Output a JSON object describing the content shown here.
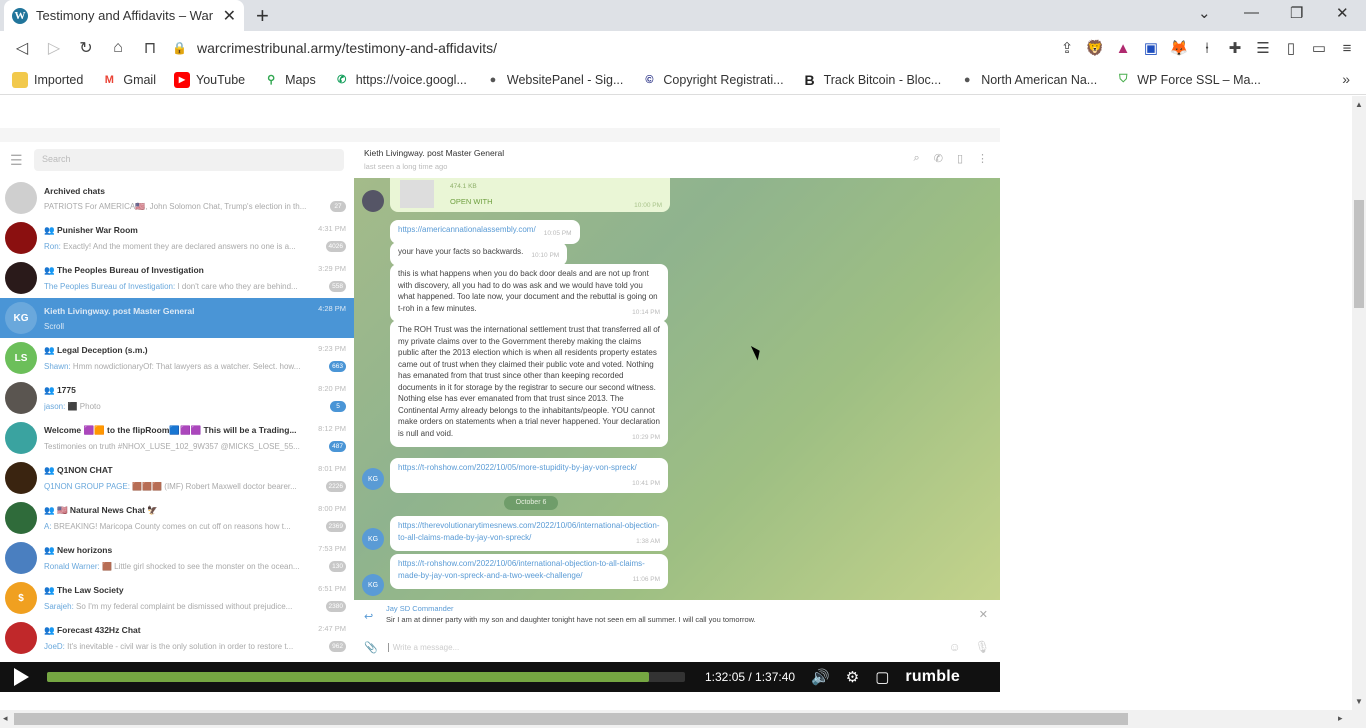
{
  "browser": {
    "tab_title": "Testimony and Affidavits – War Cr",
    "favicon": "wordpress-icon",
    "url": "warcrimestribunal.army/testimony-and-affidavits/",
    "bookmarks": [
      {
        "label": "Imported",
        "icon": "folder-icon",
        "color": "#f2c94c"
      },
      {
        "label": "Gmail",
        "icon": "gmail-icon",
        "color": "#ea4335"
      },
      {
        "label": "YouTube",
        "icon": "youtube-icon",
        "color": "#ff0000"
      },
      {
        "label": "Maps",
        "icon": "maps-icon",
        "color": "#34a853"
      },
      {
        "label": "https://voice.googl...",
        "icon": "phone-icon",
        "color": "#0f9d58"
      },
      {
        "label": "WebsitePanel - Sig...",
        "icon": "globe-icon",
        "color": "#555555"
      },
      {
        "label": "Copyright Registrati...",
        "icon": "copyright-icon",
        "color": "#1a237e"
      },
      {
        "label": "Track Bitcoin - Bloc...",
        "icon": "b-icon",
        "color": "#222222"
      },
      {
        "label": "North American Na...",
        "icon": "globe-icon",
        "color": "#555555"
      },
      {
        "label": "WP Force SSL – Ma...",
        "icon": "shield-icon",
        "color": "#4caf50"
      }
    ]
  },
  "telegram": {
    "search_placeholder": "Search",
    "chats": [
      {
        "name": "Archived chats",
        "preview": "PATRIOTS For AMERICA🇺🇸, John Solomon Chat, Trump's election in th...",
        "sender": "",
        "time": "",
        "badge": "27",
        "avatar_color": "#cfcfcf",
        "initials": "",
        "group": false
      },
      {
        "name": "Punisher War Room",
        "sender": "Ron:",
        "preview": "Exactly! And the moment they are declared answers no one is a...",
        "time": "4:31 PM",
        "badge": "4026",
        "avatar_color": "#8b1010",
        "initials": "",
        "group": true
      },
      {
        "name": "The Peoples Bureau of Investigation",
        "sender": "The Peoples Bureau of Investigation:",
        "preview": "I don't care who they are behind...",
        "time": "3:29 PM",
        "badge": "558",
        "avatar_color": "#2a1a1a",
        "initials": "",
        "group": true
      },
      {
        "name": "Kieth Livingway. post Master General",
        "sender": "",
        "preview": "Scroll",
        "time": "4:28 PM",
        "badge": "",
        "avatar_color": "#6aa8dc",
        "initials": "KG",
        "group": false,
        "selected": true
      },
      {
        "name": "Legal Deception (s.m.)",
        "sender": "Shawn:",
        "preview": "Hmm nowdictionaryOf: That lawyers as a watcher. Select. how...",
        "time": "9:23 PM",
        "badge": "663",
        "avatar_color": "#6cbf5a",
        "initials": "LS",
        "group": true,
        "badge_blue": true
      },
      {
        "name": "1775",
        "sender": "jason:",
        "preview": "⬛ Photo",
        "time": "8:20 PM",
        "badge": "5",
        "avatar_color": "#5a5550",
        "initials": "",
        "group": true,
        "badge_blue": true
      },
      {
        "name": "Welcome 🟪🟧 to the flipRoom🟦🟪🟪 This will be a Trading...",
        "sender": "",
        "preview": "Testimonies on truth #NHOX_LUSE_102_9W357 @MICKS_LOSE_55...",
        "time": "8:12 PM",
        "badge": "487",
        "avatar_color": "#3aa3a0",
        "initials": "",
        "group": false,
        "badge_blue": true
      },
      {
        "name": "Q1NON CHAT",
        "sender": "Q1NON GROUP PAGE:",
        "preview": "🟫🟫🟫 (IMF) Robert Maxwell doctor bearer...",
        "time": "8:01 PM",
        "badge": "2226",
        "avatar_color": "#3a2410",
        "initials": "",
        "group": true
      },
      {
        "name": "🇺🇸 Natural News Chat 🦅",
        "sender": "A:",
        "preview": "BREAKING! Maricopa County comes on cut off on reasons how t...",
        "time": "8:00 PM",
        "badge": "2369",
        "avatar_color": "#2f6b3a",
        "initials": "",
        "group": true
      },
      {
        "name": "New horizons",
        "sender": "Ronald Warner:",
        "preview": "🟫 Little girl shocked to see the monster on the ocean...",
        "time": "7:53 PM",
        "badge": "130",
        "avatar_color": "#4a7fc0",
        "initials": "",
        "group": true
      },
      {
        "name": "The Law Society",
        "sender": "Sarajeh:",
        "preview": "So I'm my federal complaint be dismissed without prejudice...",
        "time": "6:51 PM",
        "badge": "2380",
        "avatar_color": "#f0a020",
        "initials": "$",
        "group": true
      },
      {
        "name": "Forecast 432Hz Chat",
        "sender": "JoeD:",
        "preview": "It's inevitable - civil war is the only solution in order to restore t...",
        "time": "2:47 PM",
        "badge": "962",
        "avatar_color": "#c0282a",
        "initials": "",
        "group": true
      }
    ],
    "header": {
      "name": "Kieth Livingway. post Master General",
      "status": "last seen a long time ago"
    },
    "messages": [
      {
        "type": "file",
        "file_size": "474.1 KB",
        "action": "OPEN WITH",
        "time": "10:00 PM"
      },
      {
        "type": "link",
        "text": "https://americannationalassembly.com/",
        "time": "10:05 PM"
      },
      {
        "type": "text",
        "text": "your have your facts so backwards.",
        "time": "10:10 PM"
      },
      {
        "type": "text",
        "text": "this is what happens when you do back door deals and are not up front with discovery, all you had to do was ask and we would have told you what happened. Too late now, your document and the rebuttal is going on t-roh in a few minutes.",
        "time": "10:14 PM"
      },
      {
        "type": "text",
        "text": "The ROH Trust was the international settlement trust that transferred all of my private claims over to the Government thereby making the claims public after the 2013 election which is when all residents property estates came out of trust when they claimed their public vote and voted. Nothing has emanated from that trust since other than keeping recorded documents in it for storage by the registrar to secure our second witness. Nothing else has ever emanated from that trust since 2013.  The Continental Army already belongs to the inhabitants/people. YOU cannot make orders on statements when a trial never happened. Your declaration is null and void.",
        "time": "10:29 PM"
      },
      {
        "type": "link",
        "text": "https://t-rohshow.com/2022/10/05/more-stupidity-by-jay-von-spreck/",
        "time": "10:41 PM"
      },
      {
        "type": "link",
        "text": "https://therevolutionarytimesnews.com/2022/10/06/international-objection-to-all-claims-made-by-jay-von-spreck/",
        "time": "1:38 AM"
      },
      {
        "type": "link",
        "text": "https://t-rohshow.com/2022/10/06/international-objection-to-all-claims-made-by-jay-von-spreck-and-a-two-week-challenge/",
        "time": "11:06 PM"
      }
    ],
    "date_divider": "October 6",
    "reply": {
      "name": "Jay SD Commander",
      "text": "Sir I am at dinner party with my son and daughter tonight have not seen em all summer. I will call you tomorrow."
    },
    "compose_placeholder": "Write a message..."
  },
  "player": {
    "current": "1:32:05",
    "total": "1:37:40",
    "time_label": "1:32:05 / 1:37:40",
    "progress": 0.943,
    "brand": "rumble",
    "accent": "#75a642"
  }
}
